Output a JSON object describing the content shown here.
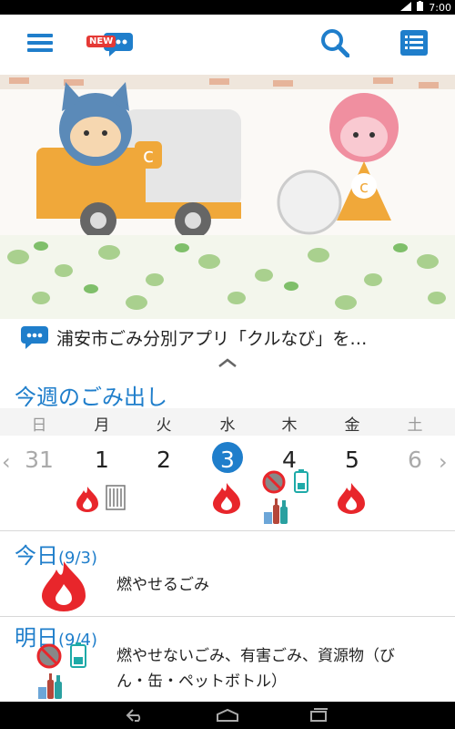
{
  "status_bar": {
    "time": "7:00"
  },
  "app_bar": {
    "menu_icon": "hamburger-icon",
    "chat_badge": "NEW",
    "search_icon": "search-icon",
    "list_icon": "list-icon"
  },
  "news": {
    "text": "浦安市ごみ分別アプリ「クルなび」を…"
  },
  "week": {
    "title": "今週のごみ出し",
    "days": [
      "日",
      "月",
      "火",
      "水",
      "木",
      "金",
      "土"
    ],
    "dates": [
      "31",
      "1",
      "2",
      "3",
      "4",
      "5",
      "6"
    ],
    "today_index": 3
  },
  "today": {
    "label": "今日",
    "date": "(9/3)",
    "description": "燃やせるごみ"
  },
  "tomorrow": {
    "label": "明日",
    "date": "(9/4)",
    "description_line1": "燃やせないごみ、有害ごみ、資源物（び",
    "description_line2": "ん・缶・ペットボトル）"
  },
  "colors": {
    "accent": "#1f7ecb",
    "burnable": "#e8262b"
  }
}
